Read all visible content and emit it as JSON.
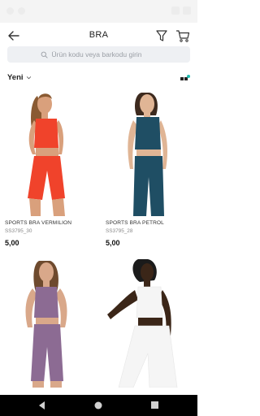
{
  "header": {
    "title": "BRA"
  },
  "search": {
    "placeholder": "Ürün kodu veya barkodu girin"
  },
  "sort": {
    "label": "Yeni"
  },
  "colors": {
    "accent": "#1dbdb0",
    "search_bg": "#eef0f3"
  },
  "icons": {
    "back": "arrow-left-icon",
    "filter": "filter-funnel-icon",
    "cart": "shopping-cart-icon",
    "search": "search-icon",
    "sort": "chevron-down-icon",
    "grid": "grid-view-icon"
  },
  "products": [
    {
      "name": "SPORTS BRA VERMILION",
      "code": "SS3795_30",
      "price": "5,00"
    },
    {
      "name": "SPORTS BRA PETROL",
      "code": "SS3795_28",
      "price": "5,00"
    },
    {
      "name": "",
      "code": "",
      "price": ""
    },
    {
      "name": "",
      "code": "",
      "price": ""
    }
  ]
}
